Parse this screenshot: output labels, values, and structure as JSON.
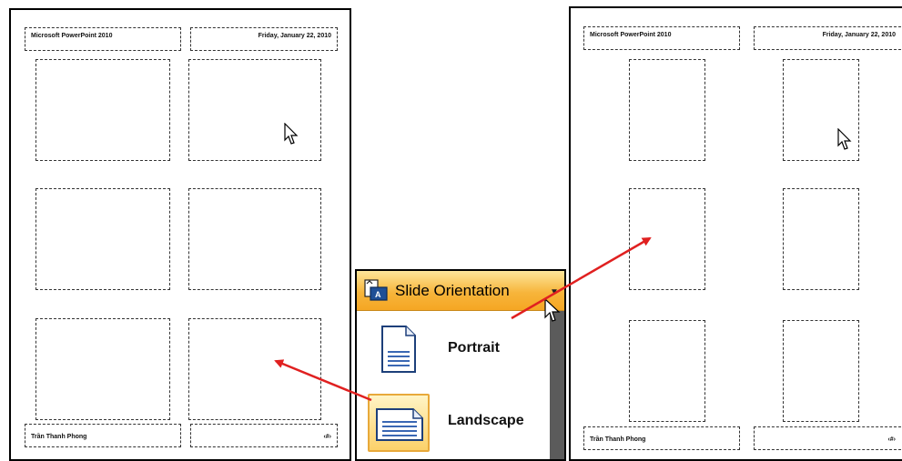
{
  "left_page": {
    "header_left": "Microsoft PowerPoint 2010",
    "header_right": "Friday, January 22, 2010",
    "footer_left": "Trần Thanh Phong",
    "footer_right": "‹#›"
  },
  "right_page": {
    "header_left": "Microsoft PowerPoint 2010",
    "header_right": "Friday, January 22, 2010",
    "footer_left": "Trần Thanh Phong",
    "footer_right": "‹#›"
  },
  "menu": {
    "title": "Slide Orientation",
    "items": [
      {
        "label": "Portrait",
        "icon": "portrait-page-icon",
        "selected": false
      },
      {
        "label": "Landscape",
        "icon": "landscape-page-icon",
        "selected": true
      }
    ]
  },
  "colors": {
    "menu_header": "#f7b53b",
    "selected_highlight": "#fcd16a",
    "arrow": "#e02020"
  }
}
